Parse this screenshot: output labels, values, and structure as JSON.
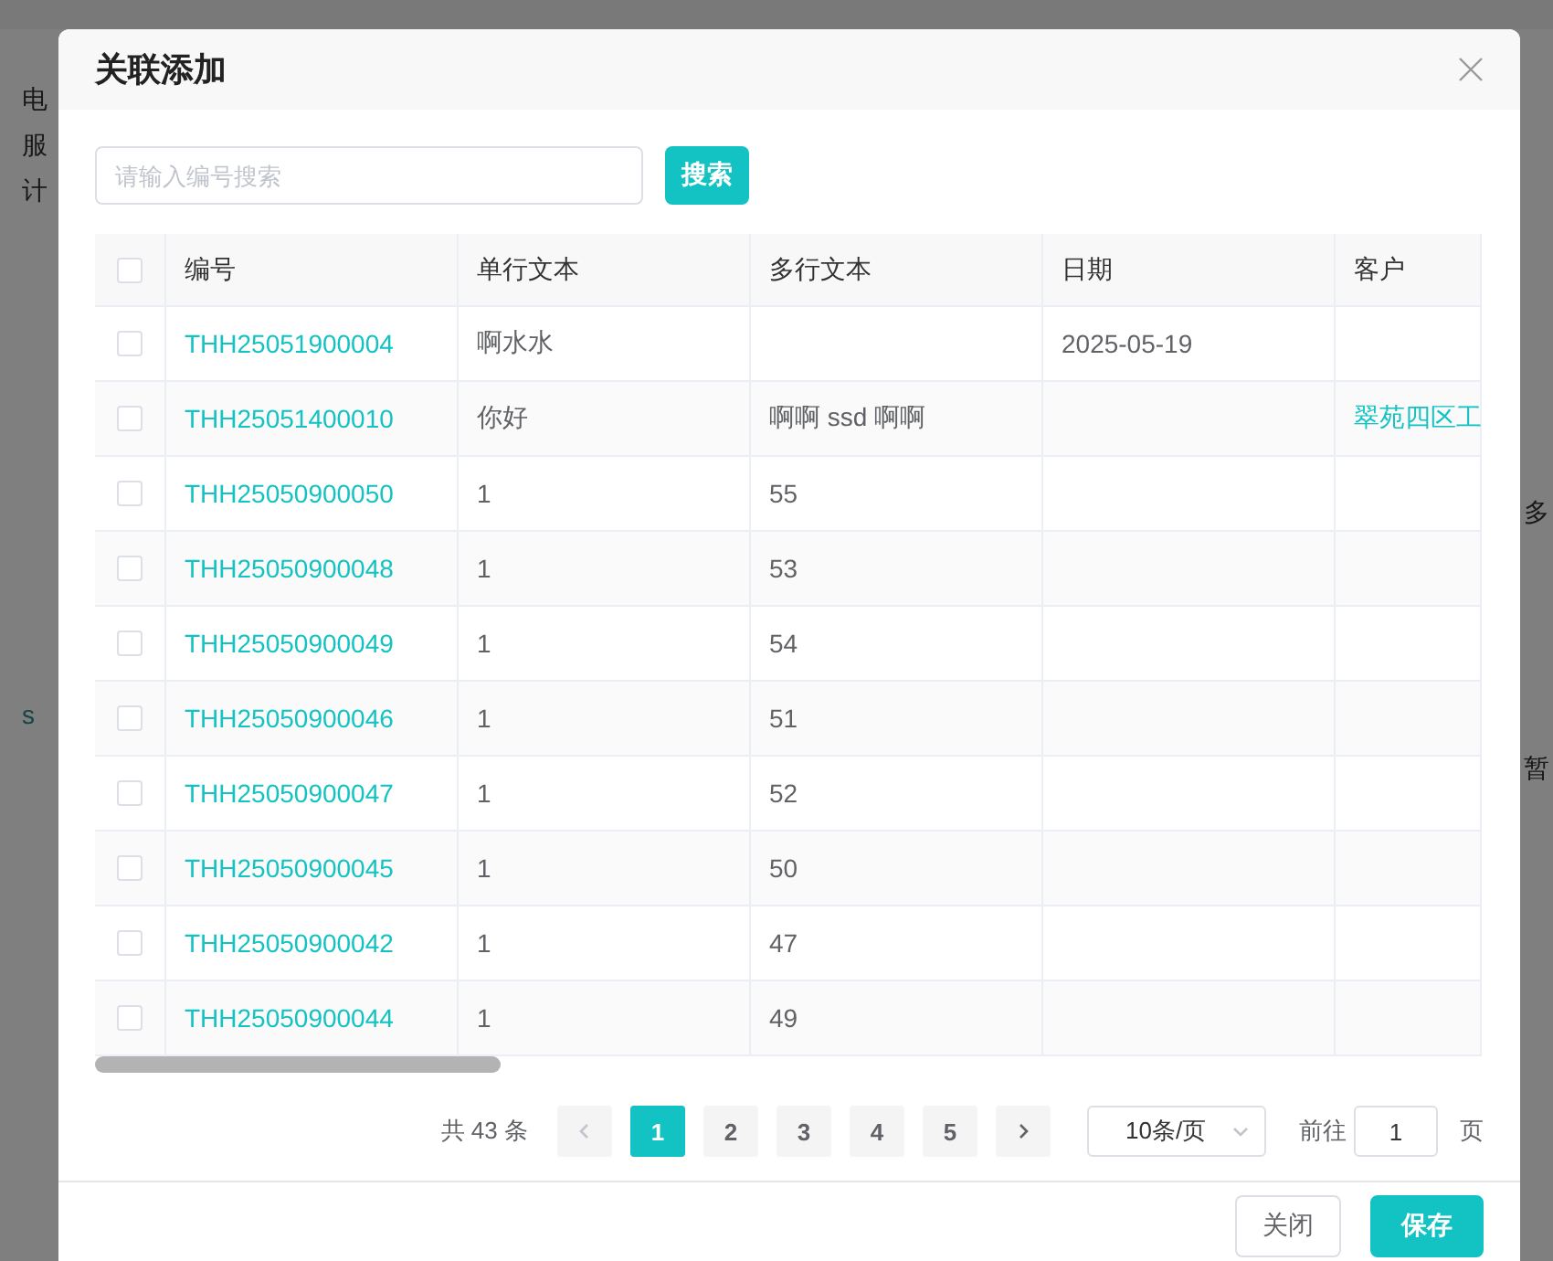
{
  "background": {
    "left_labels": [
      "电",
      "服",
      "计",
      "s"
    ],
    "right_labels": [
      "多",
      "暂"
    ]
  },
  "dialog": {
    "title": "关联添加",
    "search": {
      "placeholder": "请输入编号搜索",
      "button": "搜索"
    },
    "table": {
      "select_all": {
        "checked": false
      },
      "columns": [
        "编号",
        "单行文本",
        "多行文本",
        "日期",
        "客户"
      ],
      "rows": [
        {
          "checked": false,
          "cells": [
            "THH25051900004",
            "啊水水",
            "",
            "2025-05-19",
            ""
          ]
        },
        {
          "checked": false,
          "cells": [
            "THH25051400010",
            "你好",
            "啊啊 ssd 啊啊",
            "",
            "翠苑四区工"
          ]
        },
        {
          "checked": false,
          "cells": [
            "THH25050900050",
            "1",
            "55",
            "",
            ""
          ]
        },
        {
          "checked": false,
          "cells": [
            "THH25050900048",
            "1",
            "53",
            "",
            ""
          ]
        },
        {
          "checked": false,
          "cells": [
            "THH25050900049",
            "1",
            "54",
            "",
            ""
          ]
        },
        {
          "checked": false,
          "cells": [
            "THH25050900046",
            "1",
            "51",
            "",
            ""
          ]
        },
        {
          "checked": false,
          "cells": [
            "THH25050900047",
            "1",
            "52",
            "",
            ""
          ]
        },
        {
          "checked": false,
          "cells": [
            "THH25050900045",
            "1",
            "50",
            "",
            ""
          ]
        },
        {
          "checked": false,
          "cells": [
            "THH25050900042",
            "1",
            "47",
            "",
            ""
          ]
        },
        {
          "checked": false,
          "cells": [
            "THH25050900044",
            "1",
            "49",
            "",
            ""
          ]
        }
      ]
    },
    "pagination": {
      "total": "共 43 条",
      "prev_disabled": true,
      "pages": [
        {
          "label": "1",
          "selected": true
        },
        {
          "label": "2",
          "selected": false
        },
        {
          "label": "3",
          "selected": false
        },
        {
          "label": "4",
          "selected": false
        },
        {
          "label": "5",
          "selected": false
        }
      ],
      "page_size": "10条/页",
      "goto_label": "前往",
      "goto_value": "1",
      "goto_suffix": "页"
    },
    "buttons": [
      {
        "label": "关闭",
        "kind": "secondary"
      },
      {
        "label": "保存",
        "kind": "primary"
      }
    ]
  }
}
